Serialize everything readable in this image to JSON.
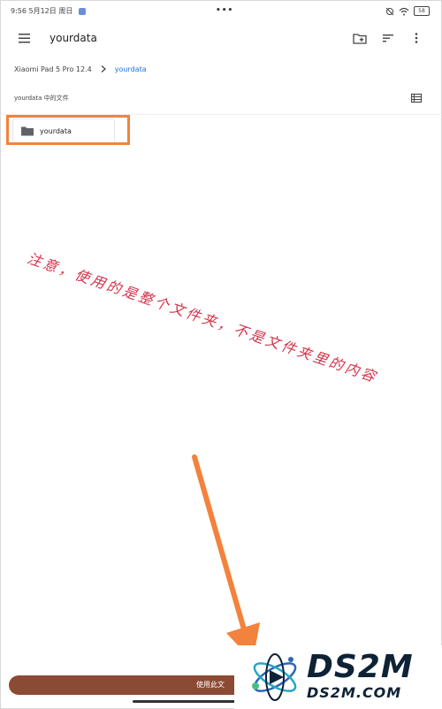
{
  "status_bar": {
    "time_date": "9:56 5月12日 周日",
    "more_dots": "•••",
    "battery": "58"
  },
  "app_bar": {
    "title": "yourdata"
  },
  "breadcrumb": {
    "root": "Xiaomi Pad 5 Pro 12.4",
    "current": "yourdata"
  },
  "section": {
    "label": "yourdata 中的文件"
  },
  "files": [
    {
      "name": "yourdata",
      "icon": "folder-icon"
    }
  ],
  "annotation": {
    "text": "注意，使用的是整个文件夹，不是文件夹里的内容"
  },
  "bottom": {
    "use_button_label": "使用此文"
  },
  "watermark": {
    "brand": "DS2M",
    "domain": "DS2M.COM"
  },
  "colors": {
    "accent_blue": "#1a73e8",
    "highlight_orange": "#f3823c",
    "annotation_red": "#d2344a",
    "button_brown": "#8b4a33"
  }
}
